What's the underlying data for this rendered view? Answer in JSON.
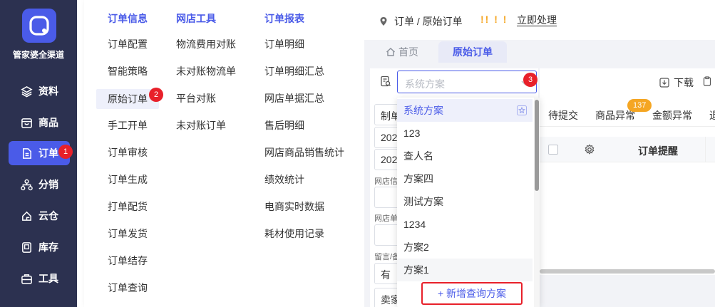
{
  "sidebar": {
    "brand": "管家婆全渠道",
    "items": [
      {
        "label": "资料",
        "icon": "layers-icon"
      },
      {
        "label": "商品",
        "icon": "box-icon"
      },
      {
        "label": "订单",
        "icon": "document-icon",
        "badge": "1"
      },
      {
        "label": "分销",
        "icon": "hierarchy-icon"
      },
      {
        "label": "云仓",
        "icon": "cloud-icon"
      },
      {
        "label": "库存",
        "icon": "inventory-icon"
      },
      {
        "label": "工具",
        "icon": "toolbox-icon"
      }
    ]
  },
  "mega_menu": {
    "columns": [
      {
        "title": "订单信息",
        "items": [
          "订单配置",
          "智能策略",
          "原始订单",
          "手工开单",
          "订单审核",
          "订单生成",
          "打单配货",
          "订单发货",
          "订单结存",
          "订单查询"
        ]
      },
      {
        "title": "网店工具",
        "items": [
          "物流费用对账",
          "未对账物流单",
          "平台对账",
          "未对账订单"
        ]
      },
      {
        "title": "订单报表",
        "items": [
          "订单明细",
          "订单明细汇总",
          "网店单据汇总",
          "售后明细",
          "网店商品销售统计",
          "绩效统计",
          "电商实时数据",
          "耗材使用记录"
        ]
      }
    ],
    "selected_badge": "2"
  },
  "header": {
    "breadcrumb": "订单 / 原始订单",
    "alert_marks": "!! ! !",
    "alert_link": "立即处理"
  },
  "tabs": {
    "home": "首页",
    "active": "原始订单"
  },
  "filter": {
    "placeholder": "系统方案",
    "badge": "3",
    "fields": [
      "制单",
      "202",
      "202",
      "有",
      "卖家"
    ],
    "labels": [
      "网店信",
      "网店单",
      "留言/备"
    ]
  },
  "dropdown": {
    "options": [
      "系统方案",
      "123",
      "查人名",
      "方案四",
      "测试方案",
      "1234",
      "方案2",
      "方案1"
    ],
    "add_label": "+ 新增查询方案"
  },
  "toolbar": {
    "download": "下载"
  },
  "status_tabs": {
    "items": [
      "待提交",
      "商品异常",
      "金额异常",
      "退"
    ],
    "count": "137"
  },
  "table": {
    "header": "订单提醒"
  },
  "colors": {
    "sidebar": "#2c3150",
    "accent": "#4a5be8",
    "badge": "#e8202a",
    "warning": "#f5a623"
  }
}
